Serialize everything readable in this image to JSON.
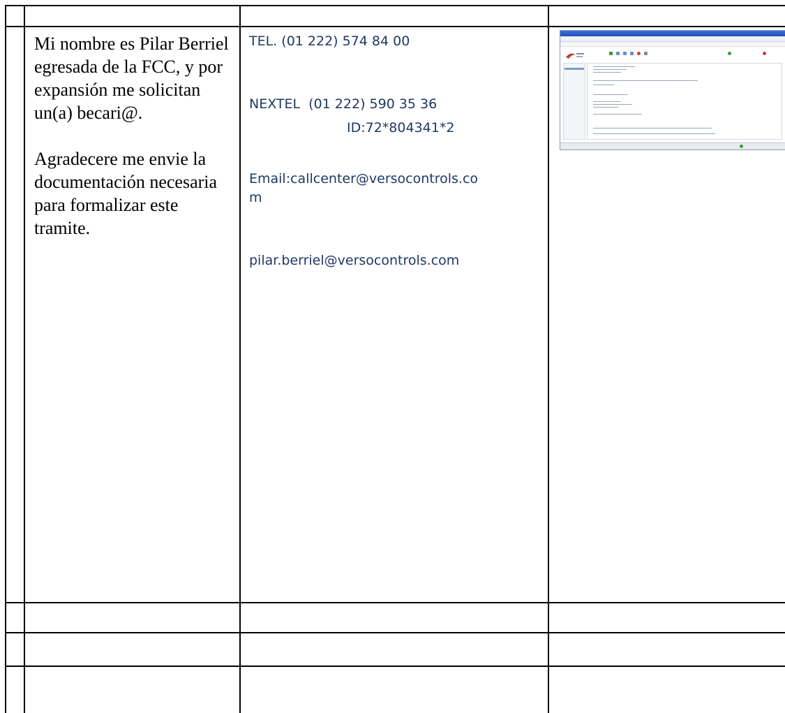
{
  "left_cell": {
    "paragraph_1": "Mi nombre es Pilar Berriel egresada de la FCC, y por expansión me solicitan un(a) becari@.",
    "paragraph_2": "Agradecere me envie la documentación necesaria para formalizar este tramite."
  },
  "contact_cell": {
    "tel": "TEL. (01 222) 574 84 00",
    "nextel": "NEXTEL  (01 222) 590 35 36",
    "id": "ID:72*804341*2",
    "email_line_1": "Email:callcenter@versocontrols.co",
    "email_line_2": "m",
    "email_2": "pilar.berriel@versocontrols.com"
  },
  "thumbnail": {
    "icon": "embedded-screenshot-thumbnail"
  },
  "colors": {
    "contact_text": "#1f3864",
    "body_text": "#000000",
    "grid": "#000000"
  }
}
